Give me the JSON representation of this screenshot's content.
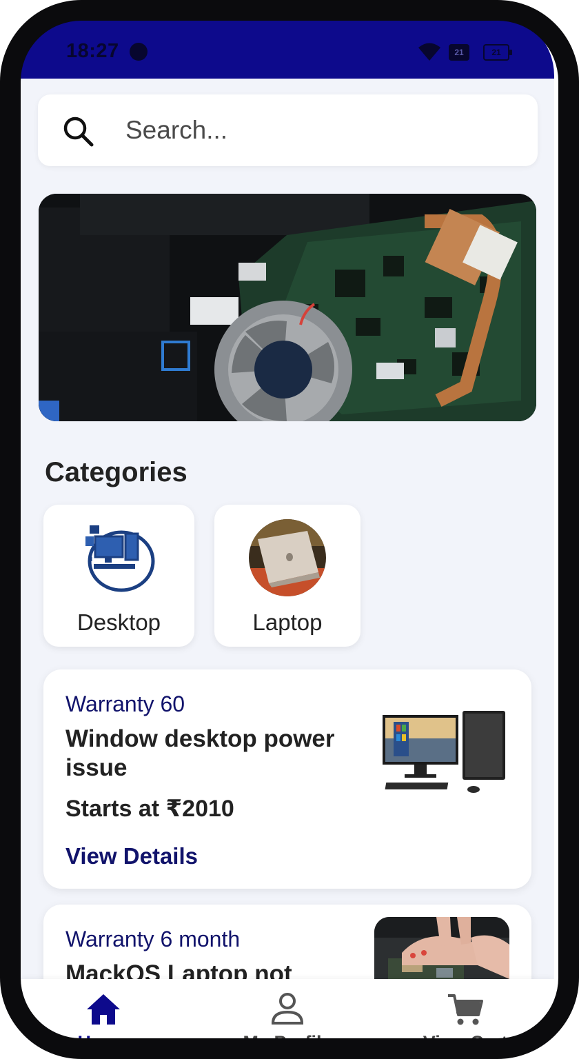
{
  "status_bar": {
    "time": "18:27",
    "battery_badge": "21",
    "battery_level": "21"
  },
  "search": {
    "placeholder": "Search..."
  },
  "categories": {
    "title": "Categories",
    "items": [
      {
        "label": "Desktop",
        "icon": "desktop-computer-icon"
      },
      {
        "label": "Laptop",
        "icon": "laptop-photo"
      }
    ]
  },
  "services": [
    {
      "warranty": "Warranty 60",
      "title": "Window desktop power issue",
      "price": "Starts at ₹2010",
      "action": "View Details"
    },
    {
      "warranty": "Warranty 6 month",
      "title": "MackOS Laptop not"
    }
  ],
  "bottom_nav": {
    "items": [
      {
        "label": "Home",
        "icon": "home-icon",
        "active": true
      },
      {
        "label": "My Profile",
        "icon": "profile-icon",
        "active": false
      },
      {
        "label": "View Cart",
        "icon": "cart-icon",
        "active": false
      }
    ]
  },
  "colors": {
    "primary": "#0d0a8c",
    "accent_text": "#11136b",
    "background": "#f2f4fa"
  }
}
